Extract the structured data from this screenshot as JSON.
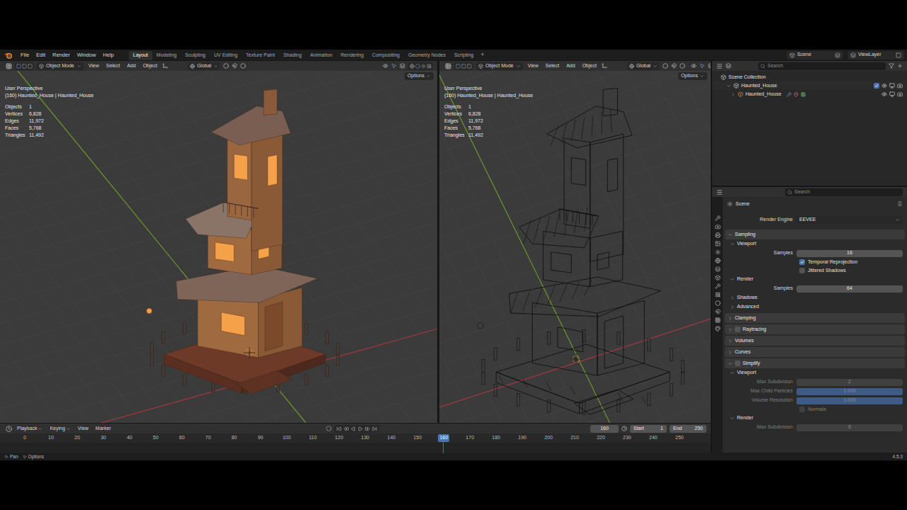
{
  "top_bar": {
    "menu": [
      "File",
      "Edit",
      "Render",
      "Window",
      "Help"
    ],
    "workspaces": [
      {
        "label": "Layout",
        "selected": true
      },
      {
        "label": "Modeling",
        "selected": false
      },
      {
        "label": "Sculpting",
        "selected": false
      },
      {
        "label": "UV Editing",
        "selected": false
      },
      {
        "label": "Texture Paint",
        "selected": false
      },
      {
        "label": "Shading",
        "selected": false
      },
      {
        "label": "Animation",
        "selected": false
      },
      {
        "label": "Rendering",
        "selected": false
      },
      {
        "label": "Compositing",
        "selected": false
      },
      {
        "label": "Geometry Nodes",
        "selected": false
      },
      {
        "label": "Scripting",
        "selected": false
      }
    ],
    "add_tab": "+",
    "scene": "Scene",
    "view_layer": "ViewLayer"
  },
  "viewports": [
    {
      "kind": "solid",
      "mode": "Object Mode",
      "menus": [
        "View",
        "Select",
        "Add",
        "Object"
      ],
      "orientation": "Global",
      "options": "Options",
      "view_name": "User Perspective",
      "object_line": "(160) Haunted_House | Haunted_House",
      "stats": [
        {
          "label": "Objects",
          "value": "1"
        },
        {
          "label": "Vertices",
          "value": "6,828"
        },
        {
          "label": "Edges",
          "value": "11,972"
        },
        {
          "label": "Faces",
          "value": "5,768"
        },
        {
          "label": "Triangles",
          "value": "11,492"
        }
      ]
    },
    {
      "kind": "wireframe",
      "mode": "Object Mode",
      "menus": [
        "View",
        "Select",
        "Add",
        "Object"
      ],
      "orientation": "Global",
      "options": "Options",
      "view_name": "User Perspective",
      "object_line": "(160) Haunted_House | Haunted_House",
      "stats": [
        {
          "label": "Objects",
          "value": "1"
        },
        {
          "label": "Vertices",
          "value": "6,828"
        },
        {
          "label": "Edges",
          "value": "11,972"
        },
        {
          "label": "Faces",
          "value": "5,768"
        },
        {
          "label": "Triangles",
          "value": "11,492"
        }
      ]
    }
  ],
  "outliner": {
    "search": "Search",
    "items": [
      {
        "label": "Scene Collection",
        "depth": 0,
        "kind": "scene"
      },
      {
        "label": "Haunted_House",
        "depth": 1,
        "kind": "collection",
        "expanded": true,
        "checked": true,
        "visible": true
      },
      {
        "label": "Haunted_House",
        "depth": 2,
        "kind": "object",
        "expanded": false,
        "visible": true
      }
    ]
  },
  "properties": {
    "search": "Search",
    "context": "Scene",
    "rows": [
      {
        "kind": "dropdown",
        "label": "Render Engine",
        "value": "EEVEE"
      },
      {
        "kind": "panel",
        "label": "Sampling",
        "expanded": true
      },
      {
        "kind": "subpanel",
        "label": "Viewport",
        "expanded": true
      },
      {
        "kind": "number",
        "label": "Samples",
        "value": "16",
        "disabled": false
      },
      {
        "kind": "checkbox",
        "label": "Temporal Reprojection",
        "checked": true,
        "disabled": false
      },
      {
        "kind": "checkbox",
        "label": "Jittered Shadows",
        "checked": false,
        "disabled": false
      },
      {
        "kind": "subpanel",
        "label": "Render",
        "expanded": true
      },
      {
        "kind": "number",
        "label": "Samples",
        "value": "64",
        "disabled": false
      },
      {
        "kind": "subpanel",
        "label": "Shadows",
        "expanded": false
      },
      {
        "kind": "subpanel",
        "label": "Advanced",
        "expanded": false
      },
      {
        "kind": "panel",
        "label": "Clamping",
        "expanded": false
      },
      {
        "kind": "panel",
        "label": "Raytracing",
        "expanded": false,
        "checkbox": false
      },
      {
        "kind": "panel",
        "label": "Volumes",
        "expanded": false
      },
      {
        "kind": "panel",
        "label": "Curves",
        "expanded": false
      },
      {
        "kind": "panel",
        "label": "Simplify",
        "expanded": true,
        "checkbox": false
      },
      {
        "kind": "subpanel",
        "label": "Viewport",
        "expanded": true
      },
      {
        "kind": "number",
        "label": "Max Subdivision",
        "value": "2",
        "disabled": true
      },
      {
        "kind": "number",
        "label": "Max Child Particles",
        "value": "1.000",
        "level": 1,
        "disabled": true
      },
      {
        "kind": "number",
        "label": "Volume Resolution",
        "value": "1.000",
        "level": 1,
        "disabled": true
      },
      {
        "kind": "checkbox",
        "label": "Normals",
        "checked": false,
        "disabled": true
      },
      {
        "kind": "subpanel",
        "label": "Render",
        "expanded": true
      },
      {
        "kind": "number",
        "label": "Max Subdivision",
        "value": "6",
        "disabled": true
      }
    ]
  },
  "timeline": {
    "menus": [
      "Playback",
      "Keying",
      "View",
      "Marker"
    ],
    "current_frame": "160",
    "start_label": "Start",
    "start": "1",
    "end_label": "End",
    "end": "250",
    "ruler": [
      "0",
      "10",
      "20",
      "30",
      "40",
      "50",
      "60",
      "70",
      "80",
      "90",
      "100",
      "110",
      "120",
      "130",
      "140",
      "150",
      "160",
      "170",
      "180",
      "190",
      "200",
      "210",
      "220",
      "230",
      "240",
      "250"
    ]
  },
  "status_bar": {
    "hints": [
      "Pan",
      "Options"
    ],
    "version": "4.5.3"
  }
}
